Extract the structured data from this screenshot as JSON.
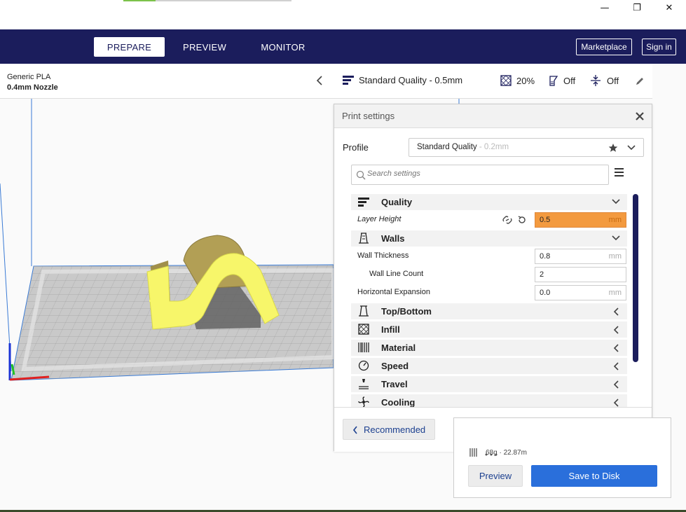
{
  "window": {
    "minimize_glyph": "—",
    "restore_glyph": "❐",
    "close_glyph": "✕"
  },
  "header": {
    "tabs": [
      {
        "label": "PREPARE",
        "active": true
      },
      {
        "label": "PREVIEW",
        "active": false
      },
      {
        "label": "MONITOR",
        "active": false
      }
    ],
    "marketplace_label": "Marketplace",
    "signin_label": "Sign in"
  },
  "material_panel": {
    "material": "Generic PLA",
    "nozzle": "0.4mm Nozzle",
    "collapse_icon": "chevron-left-icon"
  },
  "quality_bar": {
    "profile": "Standard Quality - 0.5mm",
    "infill": "20%",
    "support": "Off",
    "adhesion": "Off",
    "edit_icon": "pencil-icon"
  },
  "print_settings": {
    "title": "Print settings",
    "profile_label": "Profile",
    "profile_name": "Standard Quality",
    "profile_sub": " - 0.2mm",
    "search_placeholder": "Search settings",
    "sections": {
      "quality": "Quality",
      "walls": "Walls",
      "top_bottom": "Top/Bottom",
      "infill": "Infill",
      "material": "Material",
      "speed": "Speed",
      "travel": "Travel",
      "cooling": "Cooling"
    },
    "settings": {
      "layer_height": {
        "label": "Layer Height",
        "value": "0.5",
        "unit": "mm"
      },
      "wall_thickness": {
        "label": "Wall Thickness",
        "value": "0.8",
        "unit": "mm"
      },
      "wall_line_count": {
        "label": "Wall Line Count",
        "value": "2"
      },
      "horizontal_expansion": {
        "label": "Horizontal Expansion",
        "value": "0.0",
        "unit": "mm"
      }
    },
    "recommended_label": "Recommended"
  },
  "action_panel": {
    "estimate": "68g · 22.87m",
    "preview_label": "Preview",
    "save_label": "Save to Disk"
  },
  "colors": {
    "header_bg": "#1b1d5c",
    "accent_blue": "#2a6fdb",
    "highlight_orange": "#f39a3f",
    "model_yellow": "#f7f66a",
    "model_tan": "#b29f55"
  }
}
